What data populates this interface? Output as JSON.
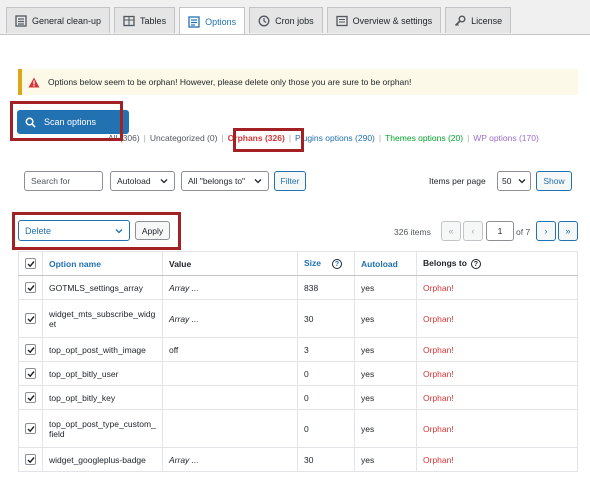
{
  "tabs": [
    {
      "label": "General clean-up",
      "icon": "broom-icon"
    },
    {
      "label": "Tables",
      "icon": "table-icon"
    },
    {
      "label": "Options",
      "icon": "options-icon"
    },
    {
      "label": "Cron jobs",
      "icon": "clock-icon"
    },
    {
      "label": "Overview & settings",
      "icon": "overview-icon"
    },
    {
      "label": "License",
      "icon": "key-icon"
    }
  ],
  "notice": {
    "text": "Options below seem to be orphan! However, please delete only those you are sure to be orphan!",
    "icon": "warning-icon"
  },
  "scan": {
    "label": "Scan options",
    "icon": "search-icon"
  },
  "subsub": {
    "all": "All (306)",
    "uncategorized": "Uncategorized (0)",
    "orphans": "Orphans (326)",
    "plugins": "Plugins options (290)",
    "themes": "Themes options (20)",
    "wp": "WP options (170)"
  },
  "filters": {
    "search_placeholder": "Search for",
    "autoload": "Autoload",
    "belongs": "All \"belongs to\"",
    "filter_btn": "Filter",
    "ipp_label": "Items per page",
    "ipp_value": "50",
    "show_btn": "Show"
  },
  "bulk": {
    "selected": "Delete",
    "apply": "Apply"
  },
  "pagination": {
    "count": "326 items",
    "first": "«",
    "prev": "‹",
    "current": "1",
    "of": "of 7",
    "next": "›",
    "last": "»"
  },
  "table": {
    "headers": {
      "name": "Option name",
      "value": "Value",
      "size": "Size",
      "autoload": "Autoload",
      "belongs": "Belongs to"
    },
    "rows": [
      {
        "name": "GOTMLS_settings_array",
        "value": "Array ...",
        "size": "838",
        "autoload": "yes",
        "belongs": "Orphan!"
      },
      {
        "name": "widget_mts_subscribe_widget",
        "value": "Array ...",
        "size": "30",
        "autoload": "yes",
        "belongs": "Orphan!"
      },
      {
        "name": "top_opt_post_with_image",
        "value": "off",
        "size": "3",
        "autoload": "yes",
        "belongs": "Orphan!"
      },
      {
        "name": "top_opt_bitly_user",
        "value": "",
        "size": "0",
        "autoload": "yes",
        "belongs": "Orphan!"
      },
      {
        "name": "top_opt_bitly_key",
        "value": "",
        "size": "0",
        "autoload": "yes",
        "belongs": "Orphan!"
      },
      {
        "name": "top_opt_post_type_custom_field",
        "value": "",
        "size": "0",
        "autoload": "yes",
        "belongs": "Orphan!"
      },
      {
        "name": "widget_googleplus-badge",
        "value": "Array ...",
        "size": "30",
        "autoload": "yes",
        "belongs": "Orphan!"
      }
    ]
  },
  "colors": {
    "accent": "#2271b1",
    "orphan": "#d63638",
    "highlight_box": "#a32024",
    "notice_bg": "#fcf9e8"
  }
}
